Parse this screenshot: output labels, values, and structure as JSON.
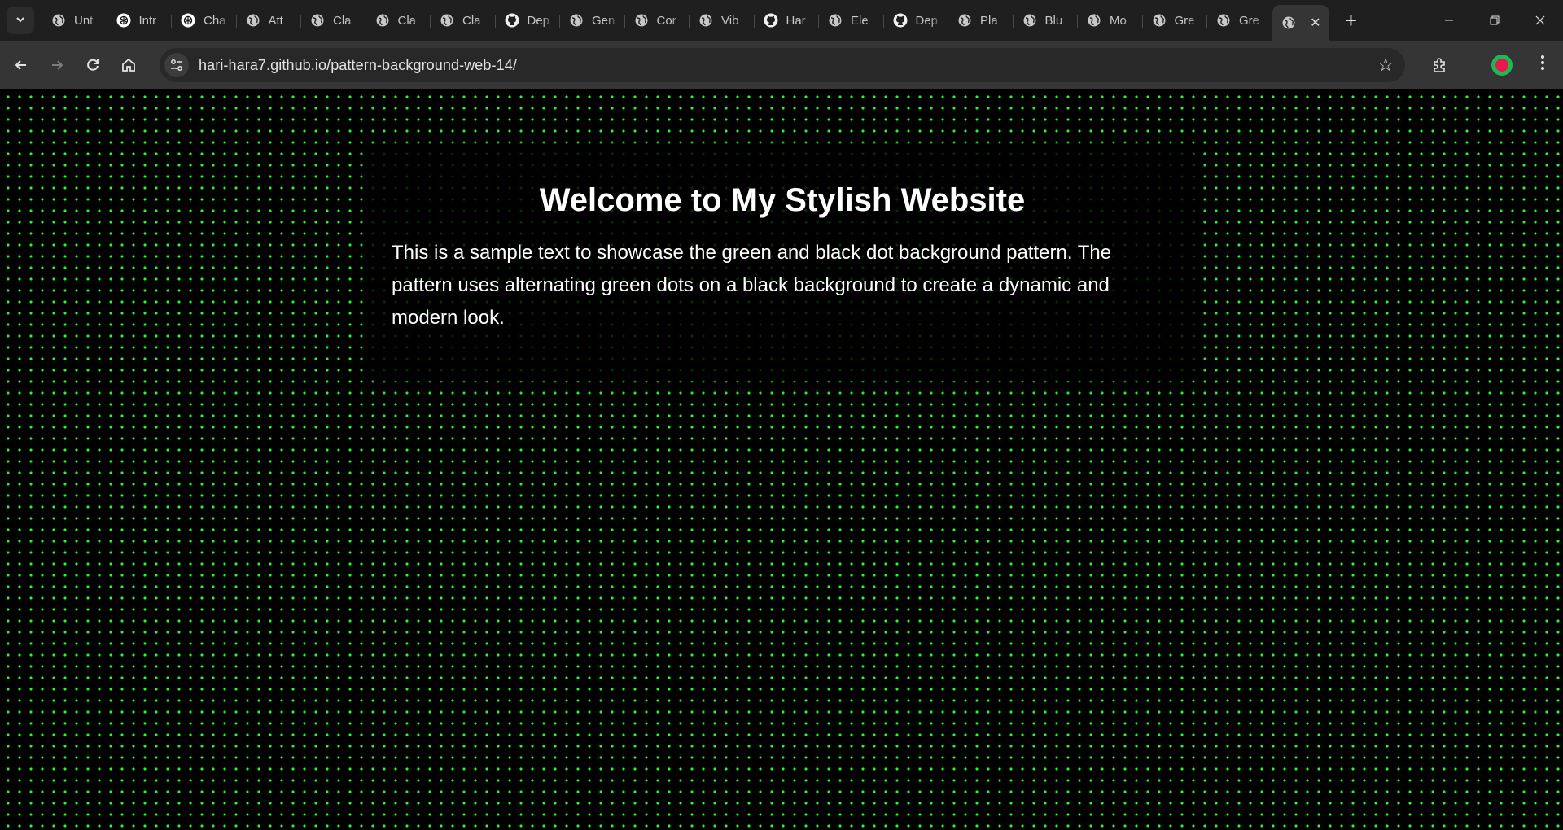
{
  "browser": {
    "tabs": [
      {
        "label": "Unt",
        "icon": "globe-icon"
      },
      {
        "label": "Intr",
        "icon": "openai-icon"
      },
      {
        "label": "Cha",
        "icon": "openai-icon"
      },
      {
        "label": "Att",
        "icon": "globe-icon"
      },
      {
        "label": "Cla",
        "icon": "globe-icon"
      },
      {
        "label": "Cla",
        "icon": "globe-icon"
      },
      {
        "label": "Cla",
        "icon": "globe-icon"
      },
      {
        "label": "Dep",
        "icon": "github-icon"
      },
      {
        "label": "Gen",
        "icon": "globe-icon"
      },
      {
        "label": "Cor",
        "icon": "globe-icon"
      },
      {
        "label": "Vib",
        "icon": "globe-icon"
      },
      {
        "label": "Har",
        "icon": "github-icon"
      },
      {
        "label": "Ele",
        "icon": "globe-icon"
      },
      {
        "label": "Dep",
        "icon": "github-icon"
      },
      {
        "label": "Pla",
        "icon": "globe-icon"
      },
      {
        "label": "Blu",
        "icon": "globe-icon"
      },
      {
        "label": "Mo",
        "icon": "globe-icon"
      },
      {
        "label": "Gre",
        "icon": "globe-icon"
      },
      {
        "label": "Gre",
        "icon": "globe-icon"
      }
    ],
    "url": "hari-hara7.github.io/pattern-background-web-14/"
  },
  "colors": {
    "dot": "#1dff1d",
    "background": "#000000"
  },
  "page": {
    "heading": "Welcome to My Stylish Website",
    "body": "This is a sample text to showcase the green and black dot background pattern. The pattern uses alternating green dots on a black background to create a dynamic and modern look."
  }
}
